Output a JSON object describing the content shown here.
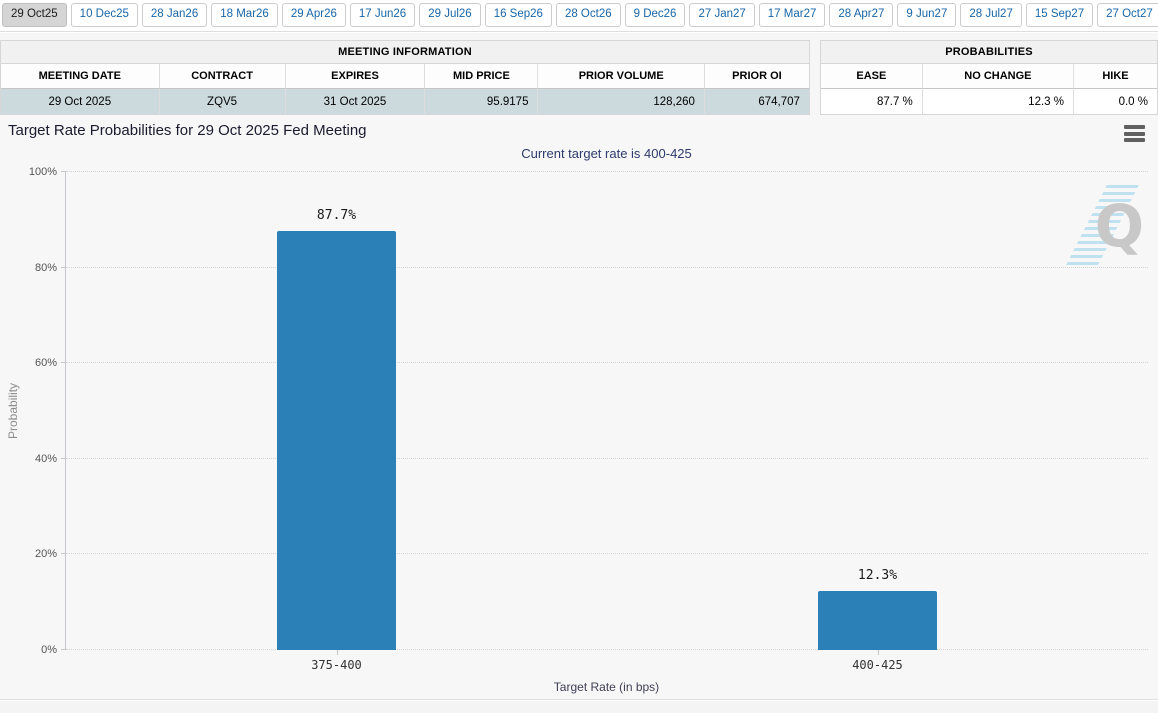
{
  "tabs": {
    "items": [
      {
        "label": "29 Oct25",
        "active": true
      },
      {
        "label": "10 Dec25",
        "active": false
      },
      {
        "label": "28 Jan26",
        "active": false
      },
      {
        "label": "18 Mar26",
        "active": false
      },
      {
        "label": "29 Apr26",
        "active": false
      },
      {
        "label": "17 Jun26",
        "active": false
      },
      {
        "label": "29 Jul26",
        "active": false
      },
      {
        "label": "16 Sep26",
        "active": false
      },
      {
        "label": "28 Oct26",
        "active": false
      },
      {
        "label": "9 Dec26",
        "active": false
      },
      {
        "label": "27 Jan27",
        "active": false
      },
      {
        "label": "17 Mar27",
        "active": false
      },
      {
        "label": "28 Apr27",
        "active": false
      },
      {
        "label": "9 Jun27",
        "active": false
      },
      {
        "label": "28 Jul27",
        "active": false
      },
      {
        "label": "15 Sep27",
        "active": false
      },
      {
        "label": "27 Oct27",
        "active": false
      }
    ]
  },
  "meeting_info": {
    "title": "MEETING INFORMATION",
    "columns": [
      "MEETING DATE",
      "CONTRACT",
      "EXPIRES",
      "MID PRICE",
      "PRIOR VOLUME",
      "PRIOR OI"
    ],
    "row": [
      "29 Oct 2025",
      "ZQV5",
      "31 Oct 2025",
      "95.9175",
      "128,260",
      "674,707"
    ]
  },
  "probabilities": {
    "title": "PROBABILITIES",
    "columns": [
      "EASE",
      "NO CHANGE",
      "HIKE"
    ],
    "row": [
      "87.7 %",
      "12.3 %",
      "0.0 %"
    ]
  },
  "icons": {
    "chart_menu": "hamburger-menu-icon"
  },
  "watermark": {
    "letter": "Q"
  },
  "chart_data": {
    "type": "bar",
    "title": "Target Rate Probabilities for 29 Oct 2025 Fed Meeting",
    "subtitle": "Current target rate is 400-425",
    "categories": [
      "375-400",
      "400-425"
    ],
    "values": [
      87.7,
      12.3
    ],
    "data_labels": [
      "87.7%",
      "12.3%"
    ],
    "xlabel": "Target Rate (in bps)",
    "ylabel": "Probability",
    "ylim": [
      0,
      100
    ],
    "yticks": [
      "0%",
      "20%",
      "40%",
      "60%",
      "80%",
      "100%"
    ],
    "bar_color": "#2c80b8",
    "grid": "horizontal-dotted",
    "legend": "none"
  },
  "colors": {
    "accent_blue": "#2c80b8",
    "tab_link_blue": "#1766a8",
    "active_tab_bg": "#d5d5d5",
    "meeting_row_bg": "#ccd9dd",
    "subtitle_navy": "#2d3a6d",
    "panel_bg": "#f7f7f7"
  }
}
